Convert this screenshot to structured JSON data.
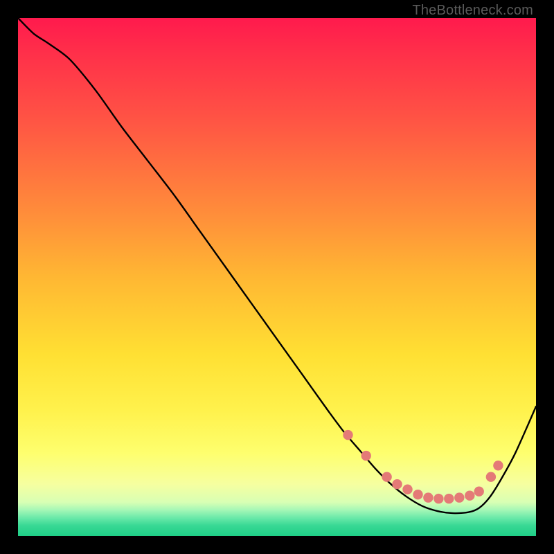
{
  "watermark": "TheBottleneck.com",
  "colors": {
    "background": "#000000",
    "gradient_top": "#ff1a4d",
    "gradient_mid": "#ffe033",
    "gradient_bottom": "#1fcf87",
    "curve": "#000000",
    "marker": "#e47a77"
  },
  "chart_data": {
    "type": "line",
    "title": "",
    "xlabel": "",
    "ylabel": "",
    "xlim": [
      0,
      100
    ],
    "ylim": [
      0,
      100
    ],
    "series": [
      {
        "name": "bottleneck-curve",
        "x": [
          0,
          3,
          6,
          10,
          15,
          20,
          25,
          30,
          35,
          40,
          45,
          50,
          55,
          60,
          63,
          66,
          69,
          72,
          75,
          78,
          81,
          84,
          87,
          89,
          91,
          93,
          96,
          100
        ],
        "y": [
          100,
          97,
          95,
          92,
          86,
          79,
          72.5,
          66,
          59,
          52,
          45,
          38,
          31,
          24,
          20,
          16.5,
          13,
          10,
          7.6,
          5.8,
          4.8,
          4.4,
          4.6,
          5.4,
          7.4,
          10.5,
          16,
          25
        ]
      }
    ],
    "markers": {
      "name": "optimal-zone-dots",
      "x": [
        63.7,
        67.2,
        71.2,
        73.2,
        75.2,
        77.2,
        79.2,
        81.2,
        83.2,
        85.2,
        87.2,
        89.0,
        91.3,
        92.7
      ],
      "y": [
        19.5,
        15.5,
        11.4,
        10.0,
        9.0,
        8.0,
        7.4,
        7.2,
        7.2,
        7.4,
        7.8,
        8.6,
        11.4,
        13.6
      ]
    },
    "annotations": [
      {
        "text": "TheBottleneck.com",
        "role": "watermark",
        "position": "top-right"
      }
    ]
  }
}
